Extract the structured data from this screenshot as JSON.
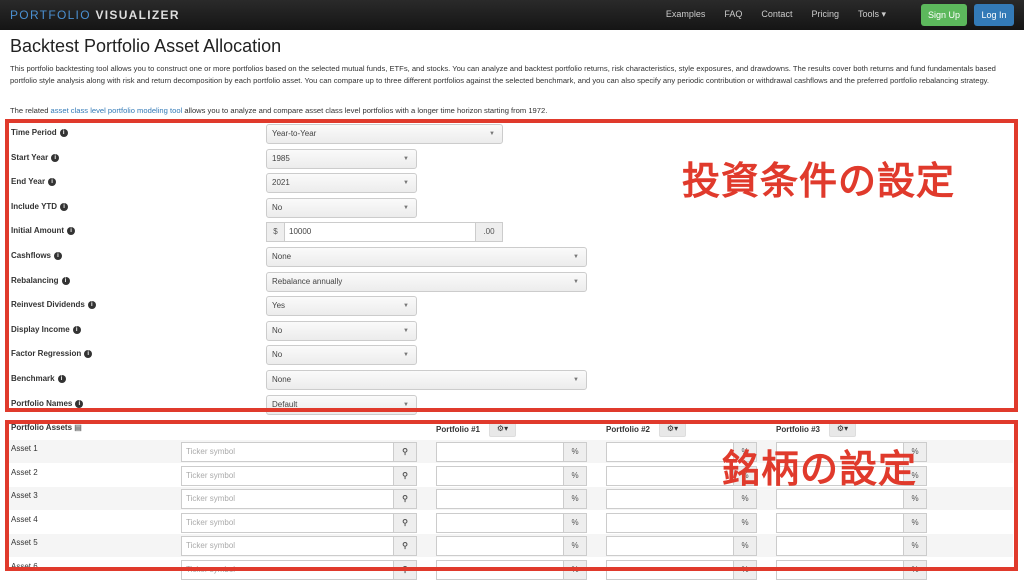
{
  "nav": {
    "brand_a": "PORTFOLIO",
    "brand_b": "VISUALIZER",
    "links": [
      "Examples",
      "FAQ",
      "Contact",
      "Pricing",
      "Tools ▾"
    ],
    "signup": "Sign Up",
    "login": "Log In"
  },
  "page": {
    "title": "Backtest Portfolio Asset Allocation",
    "intro": "This portfolio backtesting tool allows you to construct one or more portfolios based on the selected mutual funds, ETFs, and stocks. You can analyze and backtest portfolio returns, risk characteristics, style exposures, and drawdowns. The results cover both returns and fund fundamentals based portfolio style analysis along with risk and return decomposition by each portfolio asset. You can compare up to three different portfolios against the selected benchmark, and you can also specify any periodic contribution or withdrawal cashflows and the preferred portfolio rebalancing strategy.",
    "related_pre": "The related ",
    "related_link": "asset class level portfolio modeling tool",
    "related_post": " allows you to analyze and compare asset class level portfolios with a longer time horizon starting from 1972."
  },
  "annotations": {
    "settings": "投資条件の設定",
    "assets": "銘柄の設定"
  },
  "settings": [
    {
      "label": "Time Period",
      "value": "Year-to-Year"
    },
    {
      "label": "Start Year",
      "value": "1985"
    },
    {
      "label": "End Year",
      "value": "2021"
    },
    {
      "label": "Include YTD",
      "value": "No"
    },
    {
      "label": "Initial Amount",
      "prefix": "$",
      "value": "10000",
      "suffix": ".00"
    },
    {
      "label": "Cashflows",
      "value": "None"
    },
    {
      "label": "Rebalancing",
      "value": "Rebalance annually"
    },
    {
      "label": "Reinvest Dividends",
      "value": "Yes"
    },
    {
      "label": "Display Income",
      "value": "No"
    },
    {
      "label": "Factor Regression",
      "value": "No"
    },
    {
      "label": "Benchmark",
      "value": "None"
    },
    {
      "label": "Portfolio Names",
      "value": "Default"
    }
  ],
  "assets": {
    "header": "Portfolio Assets",
    "portfolios": [
      "Portfolio #1",
      "Portfolio #2",
      "Portfolio #3"
    ],
    "gear": "⚙▾",
    "placeholder": "Ticker symbol",
    "pct": "%",
    "rows": [
      "Asset 1",
      "Asset 2",
      "Asset 3",
      "Asset 4",
      "Asset 5",
      "Asset 6"
    ]
  }
}
